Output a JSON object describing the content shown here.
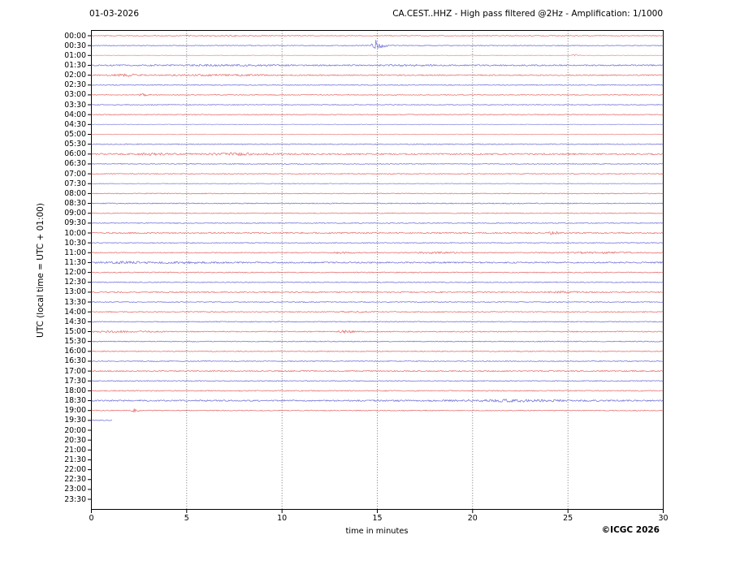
{
  "header": {
    "date": "01-03-2026",
    "title": "CA.CEST..HHZ - High pass filtered @2Hz - Amplification: 1/1000"
  },
  "y_axis": {
    "label": "UTC (local time = UTC + 01:00)"
  },
  "footer": {
    "xlabel": "time in minutes",
    "credit": "©ICGC 2026"
  },
  "chart_data": {
    "type": "line",
    "subtype": "helicorder",
    "title": "CA.CEST..HHZ - High pass filtered @2Hz - Amplification: 1/1000",
    "date": "01-03-2026",
    "xlabel": "time in minutes",
    "ylabel": "UTC (local time = UTC + 01:00)",
    "x_range_minutes": [
      0,
      30
    ],
    "x_ticks_minutes": [
      0,
      5,
      10,
      15,
      20,
      25,
      30
    ],
    "gridlines_minutes": [
      5,
      10,
      15,
      20,
      25
    ],
    "grid_on": true,
    "colors": {
      "red_trace": "#e04848",
      "blue_trace": "#4c4cd0",
      "grid": "#666666",
      "frame": "#000000"
    },
    "event_note": "impulsive seismic event on 00:30 trace at ~14.8 min",
    "data_ends_at_row": "19:30",
    "rows": [
      {
        "label": "00:00",
        "color": "red",
        "amp": 0.55,
        "events": [
          {
            "t": 7,
            "w": 1.5,
            "amp": 0.4
          }
        ]
      },
      {
        "label": "00:30",
        "color": "blue",
        "amp": 0.5,
        "events": [
          {
            "type": "quake",
            "t": 14.82,
            "amp": 9.5
          },
          {
            "t": 15.2,
            "w": 0.3,
            "amp": 0.5
          }
        ]
      },
      {
        "label": "01:00",
        "color": "red",
        "amp": 0.4,
        "opacity": 0.55,
        "events": [
          {
            "t": 25.35,
            "w": 0.15,
            "amp": 1.3
          }
        ]
      },
      {
        "label": "01:30",
        "color": "blue",
        "amp": 0.8,
        "events": [
          {
            "t": 7,
            "w": 2.5,
            "amp": 0.45
          },
          {
            "t": 17,
            "w": 1,
            "amp": 0.5
          }
        ]
      },
      {
        "label": "02:00",
        "color": "red",
        "amp": 0.7,
        "events": [
          {
            "t": 1.8,
            "w": 0.4,
            "amp": 1.1
          },
          {
            "t": 6.5,
            "w": 2.5,
            "amp": 0.5
          }
        ]
      },
      {
        "label": "02:30",
        "color": "blue",
        "amp": 0.5
      },
      {
        "label": "03:00",
        "color": "red",
        "amp": 0.5,
        "events": [
          {
            "t": 2.7,
            "w": 0.2,
            "amp": 1.2
          }
        ]
      },
      {
        "label": "03:30",
        "color": "blue",
        "amp": 0.5
      },
      {
        "label": "04:00",
        "color": "red",
        "amp": 0.5
      },
      {
        "label": "04:30",
        "color": "blue",
        "amp": 0.4,
        "opacity": 0.6
      },
      {
        "label": "05:00",
        "color": "red",
        "amp": 0.4,
        "opacity": 0.6
      },
      {
        "label": "05:30",
        "color": "blue",
        "amp": 0.55
      },
      {
        "label": "06:00",
        "color": "red",
        "amp": 0.9,
        "events": [
          {
            "t": 3.2,
            "w": 0.5,
            "amp": 1.1
          },
          {
            "t": 7.8,
            "w": 1.4,
            "amp": 0.9
          }
        ]
      },
      {
        "label": "06:30",
        "color": "blue",
        "amp": 0.5
      },
      {
        "label": "07:00",
        "color": "red",
        "amp": 0.5
      },
      {
        "label": "07:30",
        "color": "blue",
        "amp": 0.45,
        "opacity": 0.65
      },
      {
        "label": "08:00",
        "color": "red",
        "amp": 0.5
      },
      {
        "label": "08:30",
        "color": "blue",
        "amp": 0.55
      },
      {
        "label": "09:00",
        "color": "red",
        "amp": 0.5
      },
      {
        "label": "09:30",
        "color": "blue",
        "amp": 0.55
      },
      {
        "label": "10:00",
        "color": "red",
        "amp": 0.8,
        "events": [
          {
            "t": 24.3,
            "w": 0.25,
            "amp": 1.3
          }
        ]
      },
      {
        "label": "10:30",
        "color": "blue",
        "amp": 0.5
      },
      {
        "label": "11:00",
        "color": "red",
        "amp": 0.6,
        "events": [
          {
            "t": 13.2,
            "w": 0.4,
            "amp": 0.7
          },
          {
            "t": 18.2,
            "w": 0.8,
            "amp": 0.8
          },
          {
            "t": 26.5,
            "w": 1.5,
            "amp": 0.7
          }
        ]
      },
      {
        "label": "11:30",
        "color": "blue",
        "amp": 0.85,
        "events": [
          {
            "t": 1.7,
            "w": 0.8,
            "amp": 0.9
          },
          {
            "t": 5,
            "w": 0.8,
            "amp": 0.8
          }
        ]
      },
      {
        "label": "12:00",
        "color": "red",
        "amp": 0.6
      },
      {
        "label": "12:30",
        "color": "blue",
        "amp": 0.55
      },
      {
        "label": "13:00",
        "color": "red",
        "amp": 0.75,
        "events": [
          {
            "t": 24.8,
            "w": 0.5,
            "amp": 0.8
          }
        ]
      },
      {
        "label": "13:30",
        "color": "blue",
        "amp": 0.55
      },
      {
        "label": "14:00",
        "color": "red",
        "amp": 0.6,
        "events": [
          {
            "t": 13.8,
            "w": 0.5,
            "amp": 0.6
          }
        ]
      },
      {
        "label": "14:30",
        "color": "blue",
        "amp": 0.55
      },
      {
        "label": "15:00",
        "color": "red",
        "amp": 0.65,
        "events": [
          {
            "t": 1.5,
            "w": 1.2,
            "amp": 0.7
          },
          {
            "t": 13.35,
            "w": 0.25,
            "amp": 1.4
          }
        ]
      },
      {
        "label": "15:30",
        "color": "blue",
        "amp": 0.55
      },
      {
        "label": "16:00",
        "color": "red",
        "amp": 0.55
      },
      {
        "label": "16:30",
        "color": "blue",
        "amp": 0.55
      },
      {
        "label": "17:00",
        "color": "red",
        "amp": 0.7
      },
      {
        "label": "17:30",
        "color": "blue",
        "amp": 0.55
      },
      {
        "label": "18:00",
        "color": "red",
        "amp": 0.6
      },
      {
        "label": "18:30",
        "color": "blue",
        "amp": 0.9,
        "events": [
          {
            "t": 22,
            "w": 1.6,
            "amp": 1.0
          }
        ]
      },
      {
        "label": "19:00",
        "color": "red",
        "amp": 0.55,
        "events": [
          {
            "t": 2.3,
            "w": 0.12,
            "amp": 2.0
          }
        ]
      },
      {
        "label": "19:30",
        "color": "blue",
        "amp": 0.5,
        "end": 1.1
      },
      {
        "label": "20:00",
        "no_data": true
      },
      {
        "label": "20:30",
        "no_data": true
      },
      {
        "label": "21:00",
        "no_data": true
      },
      {
        "label": "21:30",
        "no_data": true
      },
      {
        "label": "22:00",
        "no_data": true
      },
      {
        "label": "22:30",
        "no_data": true
      },
      {
        "label": "23:00",
        "no_data": true
      },
      {
        "label": "23:30",
        "no_data": true
      }
    ]
  }
}
